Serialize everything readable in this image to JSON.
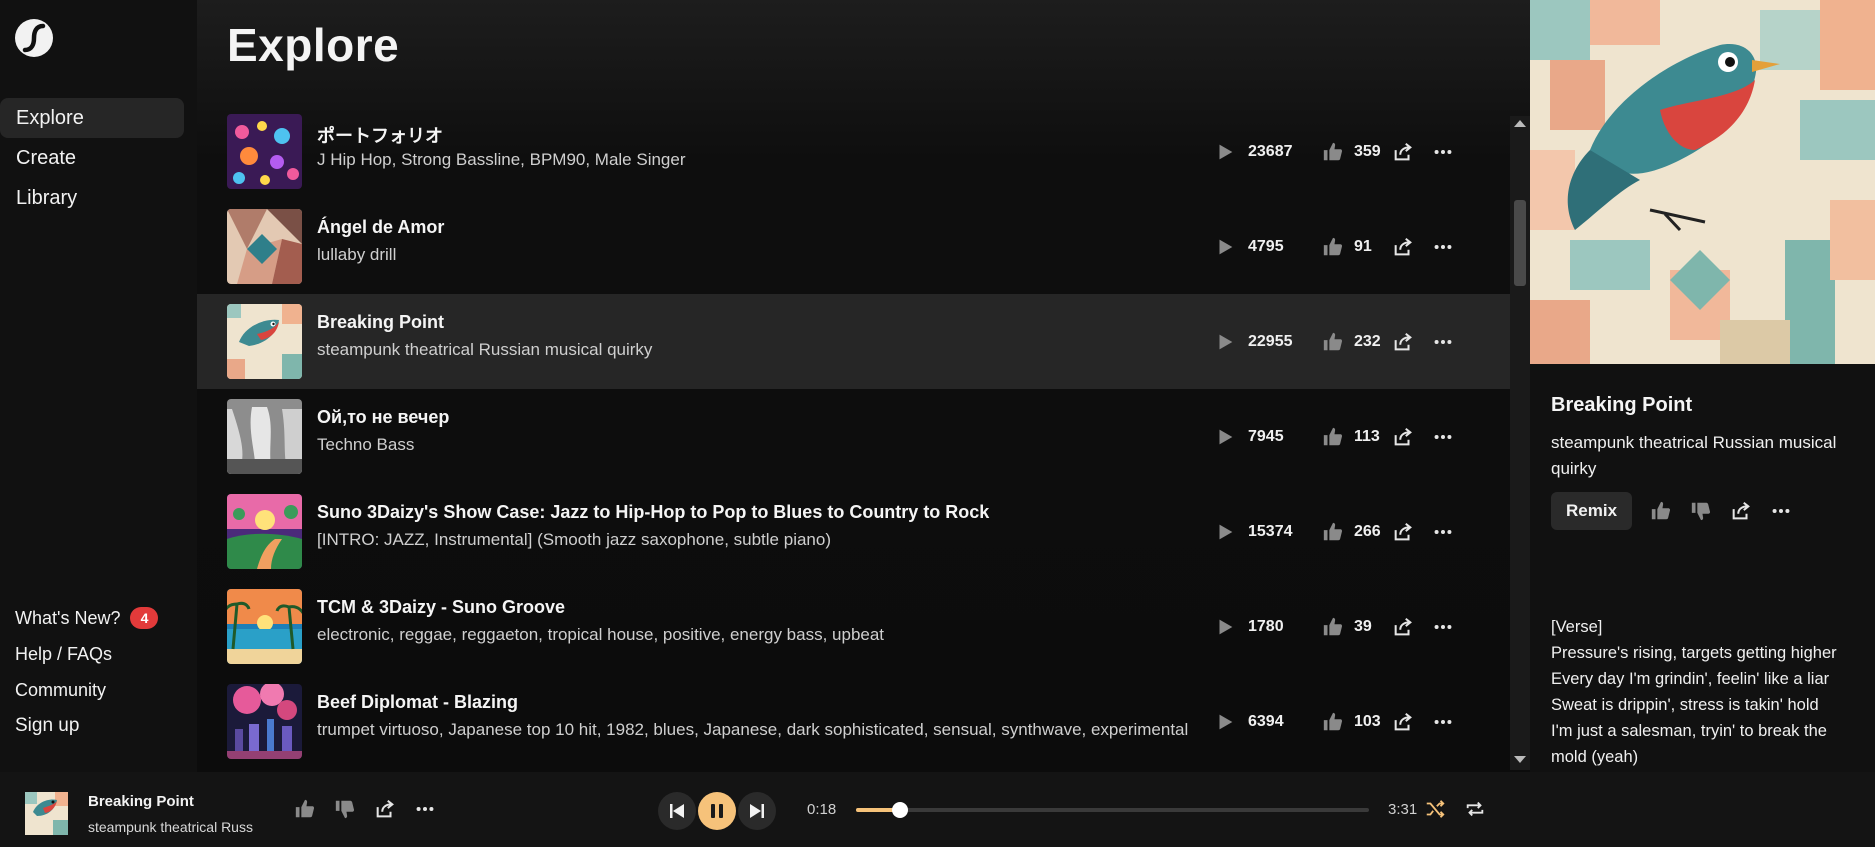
{
  "colors": {
    "accent": "#f6c27a",
    "badge": "#e23a3a",
    "active_row": "#262626"
  },
  "sidebar": {
    "nav": [
      {
        "label": "Explore",
        "active": true
      },
      {
        "label": "Create",
        "active": false
      },
      {
        "label": "Library",
        "active": false
      }
    ],
    "whats_new": "What's New?",
    "whats_new_count": "4",
    "help": "Help / FAQs",
    "community": "Community",
    "sign_up": "Sign up"
  },
  "main": {
    "title": "Explore",
    "songs": [
      {
        "title": "ポートフォリオ",
        "tags": "J Hip Hop, Strong Bassline, BPM90, Male Singer",
        "plays": "23687",
        "likes": "359"
      },
      {
        "title": "Ángel de Amor",
        "tags": "lullaby drill",
        "plays": "4795",
        "likes": "91"
      },
      {
        "title": "Breaking Point",
        "tags": "steampunk theatrical Russian musical quirky",
        "plays": "22955",
        "likes": "232",
        "active": true
      },
      {
        "title": "Ой,то не вечер",
        "tags": "Techno Bass",
        "plays": "7945",
        "likes": "113"
      },
      {
        "title": "Suno 3Daizy's Show Case: Jazz to Hip-Hop to Pop to Blues to Country to Rock",
        "tags": "[INTRO: JAZZ, Instrumental] (Smooth jazz saxophone, subtle piano)",
        "plays": "15374",
        "likes": "266"
      },
      {
        "title": "TCM & 3Daizy - Suno Groove",
        "tags": "electronic, reggae, reggaeton, tropical house, positive, energy bass, upbeat",
        "plays": "1780",
        "likes": "39"
      },
      {
        "title": "Beef Diplomat - Blazing",
        "tags": "trumpet virtuoso, Japanese top 10 hit, 1982, blues, Japanese, dark sophisticated, sensual, synthwave, experimental",
        "plays": "6394",
        "likes": "103"
      }
    ]
  },
  "panel": {
    "title": "Breaking Point",
    "tags": "steampunk theatrical Russian musical quirky",
    "remix": "Remix",
    "lyrics": [
      "[Verse]",
      "Pressure's rising, targets getting higher",
      "Every day I'm grindin', feelin' like a liar",
      "Sweat is drippin', stress is takin' hold",
      "I'm just a salesman, tryin' to break the mold (yeah)"
    ]
  },
  "player": {
    "title": "Breaking Point",
    "subtitle": "steampunk theatrical Russ",
    "elapsed": "0:18",
    "duration": "3:31",
    "progress": 0.085
  }
}
